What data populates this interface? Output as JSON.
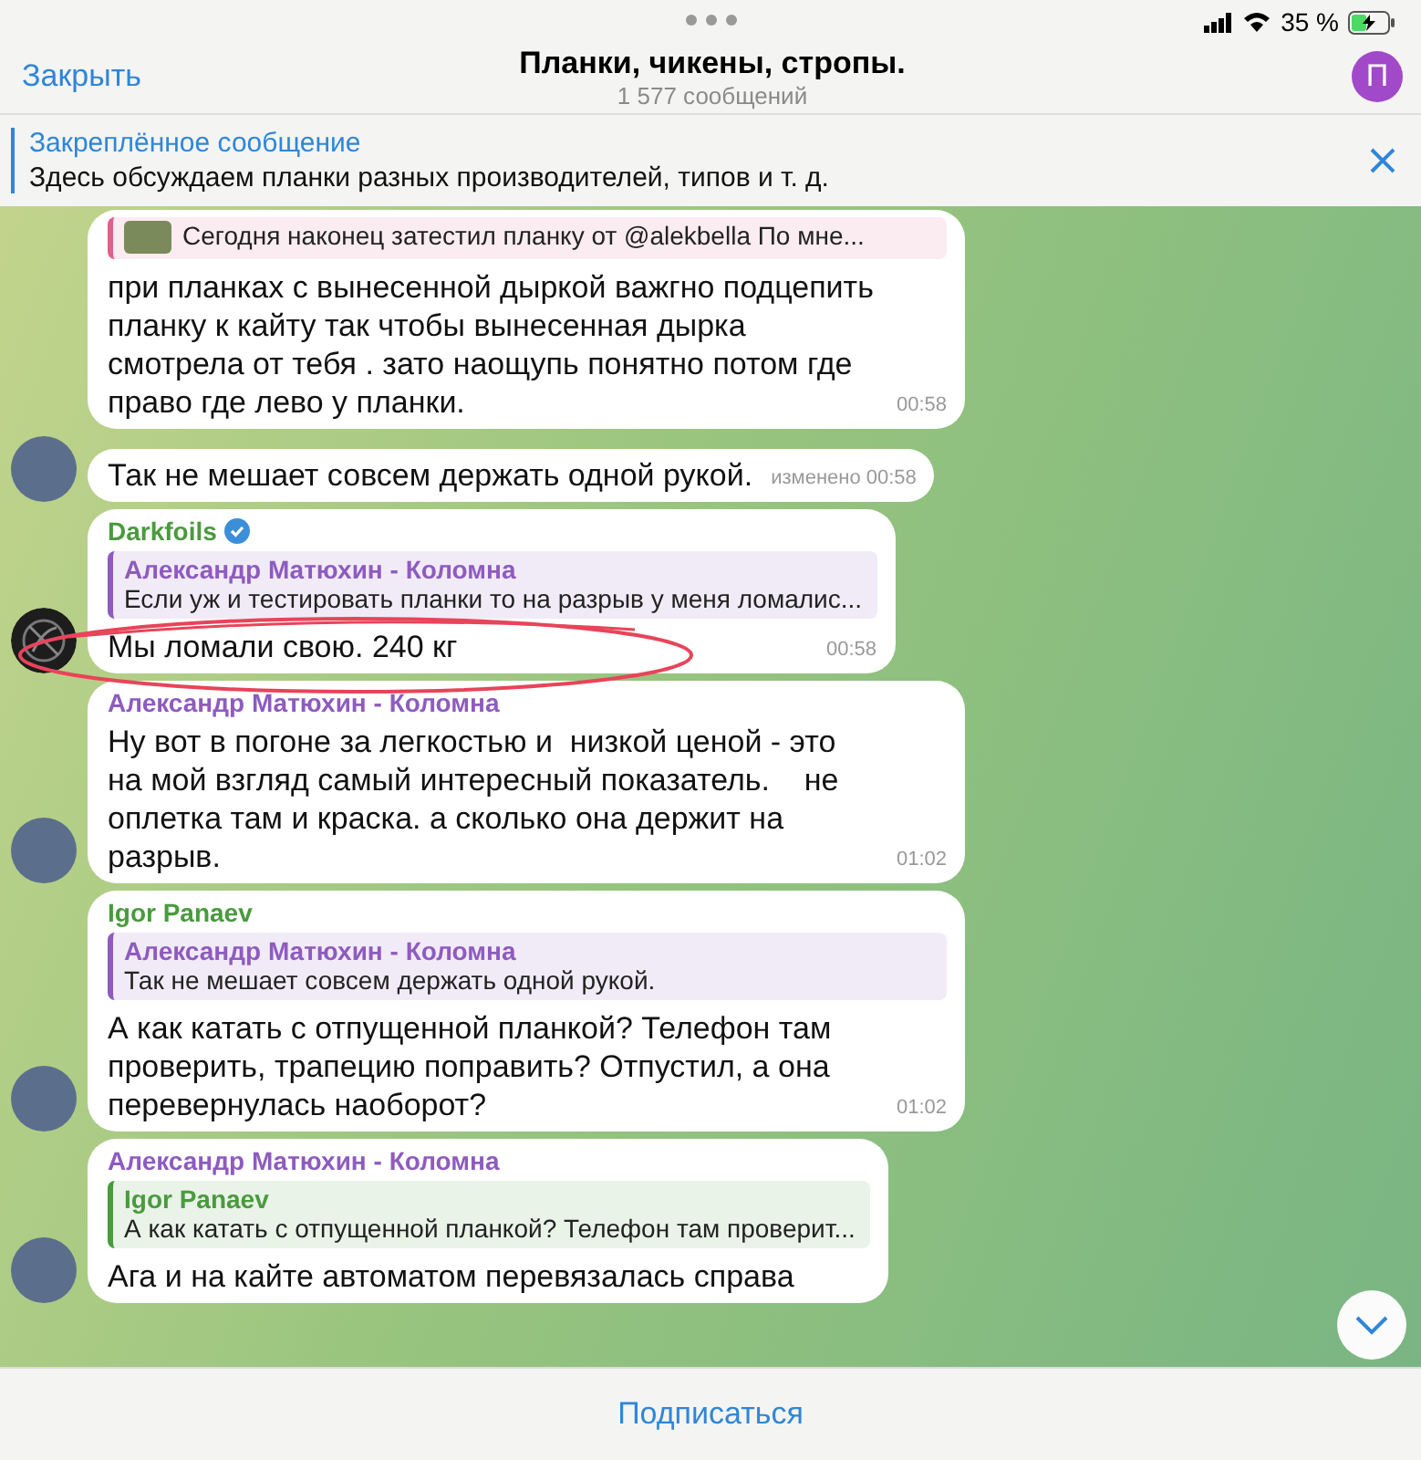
{
  "status_bar": {
    "battery_text": "35 %"
  },
  "header": {
    "close": "Закрыть",
    "title": "Планки, чикены, стропы.",
    "subtitle": "1 577 сообщений",
    "avatar_letter": "П"
  },
  "pinned": {
    "title": "Закреплённое сообщение",
    "text": "Здесь обсуждаем планки разных производителей, типов и т. д."
  },
  "messages": [
    {
      "kind": "grouped",
      "reply": {
        "text": "Сегодня наконец затестил планку от @alekbella По мне...",
        "color": "#e0608a",
        "kind": "photo"
      },
      "text": "при планках с вынесенной дыркой важгно подцепить планку к кайту так чтобы вынесенная дырка смотрела от тебя . зато наощупь понятно потом где право где лево у планки.",
      "time": "00:58"
    },
    {
      "kind": "photo",
      "text": "Так не мешает совсем держать одной рукой.",
      "time": "изменено 00:58"
    },
    {
      "kind": "logo",
      "sender": "Darkfoils",
      "color": "#4a9a3e",
      "verified": true,
      "annotated": true,
      "reply": {
        "author": "Александр Матюхин - Коломна",
        "text": "Если уж и тестировать планки то на разрыв у меня ломалис...",
        "color": "#8e5bbf",
        "kind": "text"
      },
      "text": "Мы ломали свою. 240 кг",
      "time": "00:58"
    },
    {
      "kind": "photo",
      "sender": "Александр Матюхин - Коломна",
      "color": "#8e5bbf",
      "text": "Ну вот в погоне за легкостью и  низкой ценой - это на мой взгляд самый интересный показатель.    не оплетка там и краска. а сколько она держит на разрыв.",
      "time": "01:02"
    },
    {
      "kind": "photo",
      "sender": "Igor Panaev",
      "color": "#4a9a3e",
      "reply": {
        "author": "Александр Матюхин - Коломна",
        "text": "Так не мешает совсем держать одной рукой.",
        "color": "#8e5bbf",
        "kind": "text"
      },
      "text": "А как катать с отпущенной планкой? Телефон там проверить, трапецию поправить? Отпустил, а она перевернулась наоборот?",
      "time": "01:02"
    },
    {
      "kind": "photo",
      "sender": "Александр Матюхин - Коломна",
      "color": "#8e5bbf",
      "reply": {
        "author": "Igor Panaev",
        "text": "А как катать с отпущенной планкой? Телефон там проверит...",
        "color": "#4a9a3e",
        "kind": "text"
      },
      "text": "Ага и на кайте автоматом перевязалась справа"
    }
  ],
  "footer": {
    "subscribe": "Подписаться"
  }
}
